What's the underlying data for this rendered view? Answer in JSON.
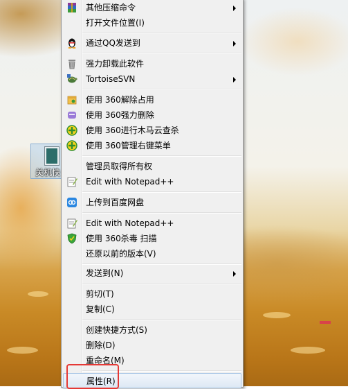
{
  "context_menu": {
    "items": [
      {
        "label": "其他压缩命令",
        "icon": "winrar-icon",
        "submenu": true
      },
      {
        "label": "打开文件位置(I)",
        "icon": "",
        "submenu": false
      },
      {
        "label": "通过QQ发送到",
        "icon": "qq-penguin-icon",
        "submenu": true
      },
      {
        "label": "强力卸载此软件",
        "icon": "trash-bin-icon",
        "submenu": false
      },
      {
        "label": "TortoiseSVN",
        "icon": "tortoisesvn-icon",
        "submenu": true
      },
      {
        "label": "使用 360解除占用",
        "icon": "360-unlock-icon",
        "submenu": false
      },
      {
        "label": "使用 360强力删除",
        "icon": "360-shredder-icon",
        "submenu": false
      },
      {
        "label": "使用 360进行木马云查杀",
        "icon": "360-scan-icon",
        "submenu": false
      },
      {
        "label": "使用 360管理右键菜单",
        "icon": "360-menu-manager-icon",
        "submenu": false
      },
      {
        "label": "管理员取得所有权",
        "icon": "",
        "submenu": false
      },
      {
        "label": "Edit with Notepad++",
        "icon": "notepadpp-icon",
        "submenu": false
      },
      {
        "label": "上传到百度网盘",
        "icon": "baidu-netdisk-icon",
        "submenu": false
      },
      {
        "label": "Edit with Notepad++",
        "icon": "notepadpp-icon",
        "submenu": false
      },
      {
        "label": "使用 360杀毒 扫描",
        "icon": "360-antivirus-shield-icon",
        "submenu": false
      },
      {
        "label": "还原以前的版本(V)",
        "icon": "",
        "submenu": false
      },
      {
        "label": "发送到(N)",
        "icon": "",
        "submenu": true
      },
      {
        "label": "剪切(T)",
        "icon": "",
        "submenu": false
      },
      {
        "label": "复制(C)",
        "icon": "",
        "submenu": false
      },
      {
        "label": "创建快捷方式(S)",
        "icon": "",
        "submenu": false
      },
      {
        "label": "删除(D)",
        "icon": "",
        "submenu": false
      },
      {
        "label": "重命名(M)",
        "icon": "",
        "submenu": false
      },
      {
        "label": "属性(R)",
        "icon": "",
        "submenu": false,
        "selected": true
      }
    ]
  },
  "desktop_icon": {
    "label": "关机快"
  },
  "colors": {
    "menu_bg": "#f0f0f0",
    "highlight_border": "#e53935",
    "selection": "#dde8f4"
  }
}
